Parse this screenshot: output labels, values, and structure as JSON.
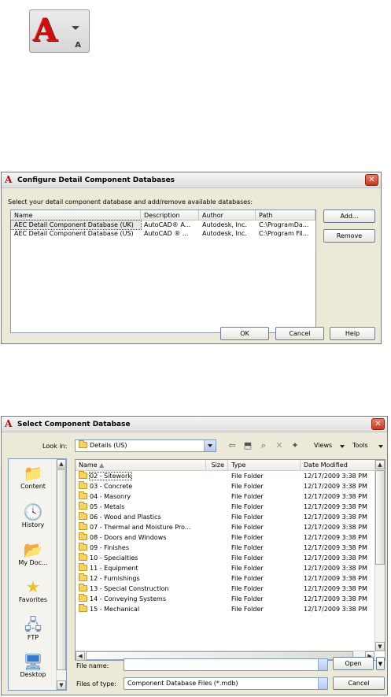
{
  "app_icon": {
    "letter": "A",
    "sub_letter": "A"
  },
  "configure_dialog": {
    "title": "Configure Detail Component Databases",
    "prompt": "Select your detail component database and add/remove available databases:",
    "columns": [
      "Name",
      "Description",
      "Author",
      "Path"
    ],
    "rows": [
      {
        "name": "AEC Detail Component Database (UK)",
        "description": "AutoCAD® A...",
        "author": "Autodesk, Inc.",
        "path": "C:\\ProgramDa..."
      },
      {
        "name": "AEC Detail Component Database (US)",
        "description": "AutoCAD ® ...",
        "author": "Autodesk, Inc.",
        "path": "C:\\Program Fil..."
      }
    ],
    "add_label": "Add...",
    "remove_label": "Remove",
    "ok_label": "OK",
    "cancel_label": "Cancel",
    "help_label": "Help",
    "close_glyph": "✕"
  },
  "select_dialog": {
    "title": "Select Component Database",
    "look_in_label": "Look in:",
    "look_in_value": "Details (US)",
    "views_label": "Views",
    "tools_label": "Tools",
    "close_glyph": "✕",
    "places": [
      {
        "label": "Content",
        "icon": "folder-icon"
      },
      {
        "label": "History",
        "icon": "history-icon"
      },
      {
        "label": "My Doc...",
        "icon": "my-documents-icon"
      },
      {
        "label": "Favorites",
        "icon": "star-icon"
      },
      {
        "label": "FTP",
        "icon": "ftp-icon"
      },
      {
        "label": "Desktop",
        "icon": "desktop-icon"
      }
    ],
    "file_columns": [
      "Name",
      "Size",
      "Type",
      "Date Modified"
    ],
    "files": [
      {
        "name": "02 - Sitework",
        "type": "File Folder",
        "date": "12/17/2009 3:38 PM"
      },
      {
        "name": "03 - Concrete",
        "type": "File Folder",
        "date": "12/17/2009 3:38 PM"
      },
      {
        "name": "04 - Masonry",
        "type": "File Folder",
        "date": "12/17/2009 3:38 PM"
      },
      {
        "name": "05 - Metals",
        "type": "File Folder",
        "date": "12/17/2009 3:38 PM"
      },
      {
        "name": "06 - Wood and Plastics",
        "type": "File Folder",
        "date": "12/17/2009 3:38 PM"
      },
      {
        "name": "07 - Thermal and Moisture Pro...",
        "type": "File Folder",
        "date": "12/17/2009 3:38 PM"
      },
      {
        "name": "08 - Doors and Windows",
        "type": "File Folder",
        "date": "12/17/2009 3:38 PM"
      },
      {
        "name": "09 - Finishes",
        "type": "File Folder",
        "date": "12/17/2009 3:38 PM"
      },
      {
        "name": "10 - Specialties",
        "type": "File Folder",
        "date": "12/17/2009 3:38 PM"
      },
      {
        "name": "11 - Equipment",
        "type": "File Folder",
        "date": "12/17/2009 3:38 PM"
      },
      {
        "name": "12 - Furnishings",
        "type": "File Folder",
        "date": "12/17/2009 3:38 PM"
      },
      {
        "name": "13 - Special Construction",
        "type": "File Folder",
        "date": "12/17/2009 3:38 PM"
      },
      {
        "name": "14 - Conveying Systems",
        "type": "File Folder",
        "date": "12/17/2009 3:38 PM"
      },
      {
        "name": "15 - Mechanical",
        "type": "File Folder",
        "date": "12/17/2009 3:38 PM"
      }
    ],
    "file_name_label": "File name:",
    "file_name_value": "",
    "files_of_type_label": "Files of type:",
    "files_of_type_value": "Component Database Files (*.mdb)",
    "open_label": "Open",
    "cancel_label": "Cancel"
  }
}
